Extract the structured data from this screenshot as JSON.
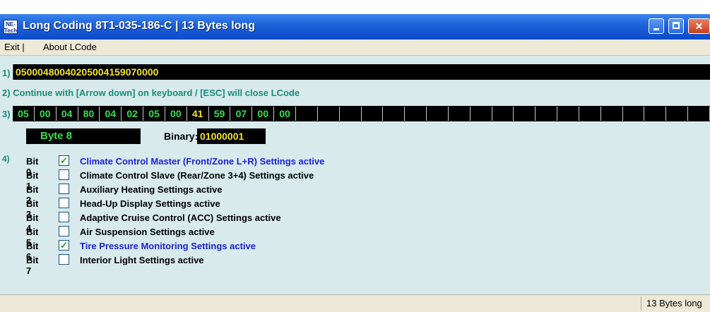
{
  "window": {
    "title": "Long Coding  8T1-035-186-C  |  13 Bytes long",
    "icon_text": "NE-Tech"
  },
  "menu": {
    "exit_label": "Exit  |",
    "about_label": "About LCode"
  },
  "step1": {
    "number": "1)",
    "code": "05000480040205004159070000"
  },
  "step2": {
    "text": "2)  Continue with [Arrow down] on keyboard / [ESC] will close LCode"
  },
  "step3": {
    "number": "3)",
    "bytes": [
      "05",
      "00",
      "04",
      "80",
      "04",
      "02",
      "05",
      "00",
      "41",
      "59",
      "07",
      "00",
      "00"
    ],
    "selected_index": 8,
    "empty_cells": 19
  },
  "byte_info": {
    "byte_label": "Byte 8",
    "binary_label": "Binary:",
    "binary_value": "01000001"
  },
  "step4": {
    "number": "4)",
    "bits": [
      {
        "label": "Bit 0",
        "checked": true,
        "description": "Climate Control Master (Front/Zone L+R) Settings active"
      },
      {
        "label": "Bit 1",
        "checked": false,
        "description": "Climate Control Slave (Rear/Zone 3+4) Settings active"
      },
      {
        "label": "Bit 2",
        "checked": false,
        "description": "Auxiliary Heating Settings active"
      },
      {
        "label": "Bit 3",
        "checked": false,
        "description": "Head-Up Display Settings active"
      },
      {
        "label": "Bit 4",
        "checked": false,
        "description": "Adaptive Cruise Control (ACC) Settings active"
      },
      {
        "label": "Bit 5",
        "checked": false,
        "description": "Air Suspension Settings active"
      },
      {
        "label": "Bit 6",
        "checked": true,
        "description": "Tire Pressure Monitoring Settings active"
      },
      {
        "label": "Bit 7",
        "checked": false,
        "description": "Interior Light Settings active"
      }
    ]
  },
  "status": {
    "text": "13 Bytes long"
  },
  "colors": {
    "window_bg": "#d8eaec",
    "code_text": "#f2e220",
    "byte_green": "#2fe04a",
    "active_blue": "#1a22d8",
    "step_teal": "#1a8b7e"
  }
}
